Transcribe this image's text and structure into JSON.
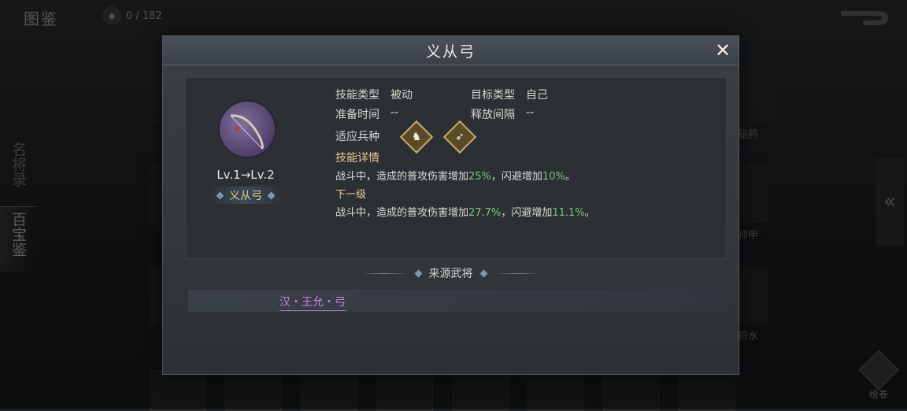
{
  "page": {
    "title": "图鉴",
    "collection_count": "0 / 182"
  },
  "side_tabs": [
    {
      "label": "名将录"
    },
    {
      "label": "百宝鉴"
    }
  ],
  "background_labels": {
    "right_1": "秘药",
    "right_2": "帅甲",
    "right_3": "符水",
    "scroll_label": "绘卷"
  },
  "modal": {
    "title": "义从弓",
    "level": "Lv.1→Lv.2",
    "skill_name": "义从弓",
    "skill_type_label": "技能类型",
    "skill_type_value": "被动",
    "target_type_label": "目标类型",
    "target_type_value": "自己",
    "prep_time_label": "准备时间",
    "prep_time_value": "--",
    "cast_interval_label": "释放间隔",
    "cast_interval_value": "--",
    "unit_label": "适应兵种",
    "details_label": "技能详情",
    "detail_prefix": "战斗中，造成的普攻伤害增加",
    "detail_v1": "25%",
    "detail_mid": "，闪避增加",
    "detail_v2": "10%",
    "detail_end": "。",
    "next_level_label": "下一级",
    "next_prefix": "战斗中，造成的普攻伤害增加",
    "next_v1": "27.7%",
    "next_mid": "，闪避增加",
    "next_v2": "11.1%",
    "next_end": "。",
    "source_title": "来源武将",
    "source_link": "汉・王允・弓"
  },
  "colors": {
    "highlight_green": "#7dc47a",
    "source_purple": "#c783e6",
    "gold": "#e6c98a"
  },
  "icons": [
    "close-icon",
    "cavalry-icon",
    "archer-icon",
    "back-arrow-icon",
    "scroll-icon",
    "chevron-left-icon"
  ]
}
